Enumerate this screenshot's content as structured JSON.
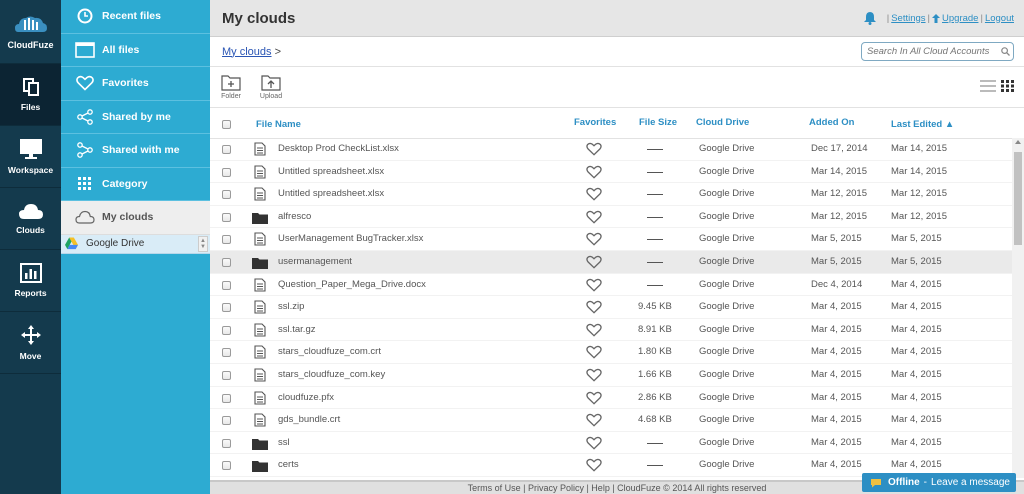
{
  "brand": {
    "name": "CloudFuze"
  },
  "rail": [
    {
      "label": "Files",
      "icon": "files-icon",
      "active": true
    },
    {
      "label": "Workspace",
      "icon": "monitor-icon",
      "active": false
    },
    {
      "label": "Clouds",
      "icon": "cloud-icon",
      "active": false
    },
    {
      "label": "Reports",
      "icon": "bar-chart-icon",
      "active": false
    },
    {
      "label": "Move",
      "icon": "move-arrows-icon",
      "active": false
    }
  ],
  "menu": [
    {
      "label": "Recent files",
      "icon": "clock-icon"
    },
    {
      "label": "All files",
      "icon": "window-icon"
    },
    {
      "label": "Favorites",
      "icon": "heart-icon"
    },
    {
      "label": "Shared by me",
      "icon": "share-icon"
    },
    {
      "label": "Shared with me",
      "icon": "shared-with-icon"
    },
    {
      "label": "Category",
      "icon": "grid-icon"
    },
    {
      "label": "My clouds",
      "icon": "cloud-outline-icon"
    }
  ],
  "cloud_sub": {
    "label": "Google Drive"
  },
  "header": {
    "title": "My clouds",
    "links": [
      "Settings",
      "Upgrade",
      "Logout"
    ],
    "separator": "|"
  },
  "breadcrumb": {
    "link": "My clouds",
    "sep": ">"
  },
  "search": {
    "placeholder": "Search In All Cloud Accounts"
  },
  "toolbar": {
    "folder": "Folder",
    "upload": "Upload"
  },
  "columns": {
    "name": "File Name",
    "favorites": "Favorites",
    "size": "File Size",
    "drive": "Cloud Drive",
    "added": "Added On",
    "edited": "Last Edited ▲"
  },
  "files": [
    {
      "name": "Desktop Prod CheckList.xlsx",
      "type": "file",
      "size": "",
      "drive": "Google Drive",
      "added": "Dec 17, 2014",
      "edited": "Mar 14, 2015",
      "highlight": false
    },
    {
      "name": "Untitled spreadsheet.xlsx",
      "type": "file",
      "size": "",
      "drive": "Google Drive",
      "added": "Mar 14, 2015",
      "edited": "Mar 14, 2015",
      "highlight": false
    },
    {
      "name": "Untitled spreadsheet.xlsx",
      "type": "file",
      "size": "",
      "drive": "Google Drive",
      "added": "Mar 12, 2015",
      "edited": "Mar 12, 2015",
      "highlight": false
    },
    {
      "name": "alfresco",
      "type": "folder",
      "size": "",
      "drive": "Google Drive",
      "added": "Mar 12, 2015",
      "edited": "Mar 12, 2015",
      "highlight": false
    },
    {
      "name": "UserManagement BugTracker.xlsx",
      "type": "file",
      "size": "",
      "drive": "Google Drive",
      "added": "Mar 5, 2015",
      "edited": "Mar 5, 2015",
      "highlight": false
    },
    {
      "name": "usermanagement",
      "type": "folder",
      "size": "",
      "drive": "Google Drive",
      "added": "Mar 5, 2015",
      "edited": "Mar 5, 2015",
      "highlight": true
    },
    {
      "name": "Question_Paper_Mega_Drive.docx",
      "type": "file",
      "size": "",
      "drive": "Google Drive",
      "added": "Dec 4, 2014",
      "edited": "Mar 4, 2015",
      "highlight": false
    },
    {
      "name": "ssl.zip",
      "type": "file",
      "size": "9.45 KB",
      "drive": "Google Drive",
      "added": "Mar 4, 2015",
      "edited": "Mar 4, 2015",
      "highlight": false
    },
    {
      "name": "ssl.tar.gz",
      "type": "file",
      "size": "8.91 KB",
      "drive": "Google Drive",
      "added": "Mar 4, 2015",
      "edited": "Mar 4, 2015",
      "highlight": false
    },
    {
      "name": "stars_cloudfuze_com.crt",
      "type": "file",
      "size": "1.80 KB",
      "drive": "Google Drive",
      "added": "Mar 4, 2015",
      "edited": "Mar 4, 2015",
      "highlight": false
    },
    {
      "name": "stars_cloudfuze_com.key",
      "type": "file",
      "size": "1.66 KB",
      "drive": "Google Drive",
      "added": "Mar 4, 2015",
      "edited": "Mar 4, 2015",
      "highlight": false
    },
    {
      "name": "cloudfuze.pfx",
      "type": "file",
      "size": "2.86 KB",
      "drive": "Google Drive",
      "added": "Mar 4, 2015",
      "edited": "Mar 4, 2015",
      "highlight": false
    },
    {
      "name": "gds_bundle.crt",
      "type": "file",
      "size": "4.68 KB",
      "drive": "Google Drive",
      "added": "Mar 4, 2015",
      "edited": "Mar 4, 2015",
      "highlight": false
    },
    {
      "name": "ssl",
      "type": "folder",
      "size": "",
      "drive": "Google Drive",
      "added": "Mar 4, 2015",
      "edited": "Mar 4, 2015",
      "highlight": false
    },
    {
      "name": "certs",
      "type": "folder",
      "size": "",
      "drive": "Google Drive",
      "added": "Mar 4, 2015",
      "edited": "Mar 4, 2015",
      "highlight": false
    }
  ],
  "footer": {
    "text": "Terms of Use  |  Privacy Policy  |  Help  |  CloudFuze © 2014  All rights reserved"
  },
  "chat": {
    "status": "Offline",
    "sep": "-",
    "action": "Leave a message"
  },
  "colors": {
    "rail": "#143a4d",
    "menu": "#2dabd2",
    "accent": "#2d8fc4"
  }
}
